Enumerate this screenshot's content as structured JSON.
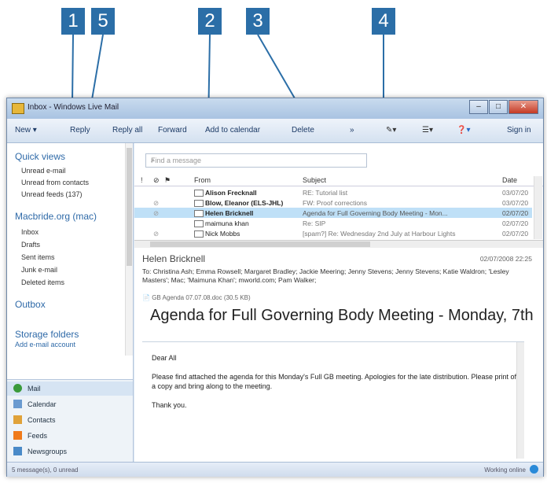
{
  "callouts": [
    "1",
    "5",
    "2",
    "3",
    "4"
  ],
  "window": {
    "title": "Inbox - Windows Live Mail"
  },
  "toolbar": {
    "new": "New ▾",
    "reply": "Reply",
    "reply_all": "Reply all",
    "forward": "Forward",
    "add_to_calendar": "Add to calendar",
    "delete": "Delete",
    "more": "»",
    "sign_in": "Sign in"
  },
  "sidebar": {
    "quick_views": "Quick views",
    "quick_items": [
      "Unread e-mail",
      "Unread from contacts",
      "Unread feeds (137)"
    ],
    "account": "Macbride.org (mac)",
    "folders": [
      "Inbox",
      "Drafts",
      "Sent items",
      "Junk e-mail",
      "Deleted items"
    ],
    "outbox": "Outbox",
    "storage": "Storage folders",
    "add_account": "Add e-mail account",
    "nav": [
      "Mail",
      "Calendar",
      "Contacts",
      "Feeds",
      "Newsgroups"
    ]
  },
  "search": {
    "placeholder": "Find a message"
  },
  "columns": {
    "from": "From",
    "subject": "Subject",
    "date": "Date"
  },
  "messages": [
    {
      "from": "Alison Frecknall",
      "subject": "RE: Tutorial list",
      "date": "03/07/20"
    },
    {
      "from": "Blow, Eleanor (ELS-JHL)",
      "subject": "FW: Proof corrections",
      "date": "03/07/20"
    },
    {
      "from": "Helen Bricknell",
      "subject": "Agenda for Full Governing Body Meeting - Mon...",
      "date": "02/07/20"
    },
    {
      "from": "maimuna khan",
      "subject": "Re: SIP",
      "date": "02/07/20"
    },
    {
      "from": "Nick Mobbs",
      "subject": "[spam?] Re: Wednesday 2nd July at Harbour Lights",
      "date": "02/07/20"
    }
  ],
  "preview": {
    "sender": "Helen Bricknell",
    "date": "02/07/2008 22:25",
    "to": "To: Christina Ash; Emma Rowsell; Margaret Bradley; Jackie Meering; Jenny Stevens; Jenny Stevens; Katie Waldron; 'Lesley Masters'; Mac; 'Maimuna Khan'; mworld.com; Pam Walker;",
    "attachment": "GB Agenda 07.07.08.doc (30.5 KB)",
    "subject": "Agenda for Full Governing Body Meeting - Monday, 7th",
    "body": [
      "Dear All",
      "Please find attached the agenda for this Monday's Full GB meeting.  Apologies for the late distribution.  Please print off a copy and bring along to the meeting.",
      "Thank you."
    ]
  },
  "status": {
    "left": "5 message(s), 0 unread",
    "right": "Working online"
  },
  "colors": {
    "callout": "#2b6ea7",
    "selected_row": "#bfe0f7",
    "link": "#2f6aa8"
  }
}
